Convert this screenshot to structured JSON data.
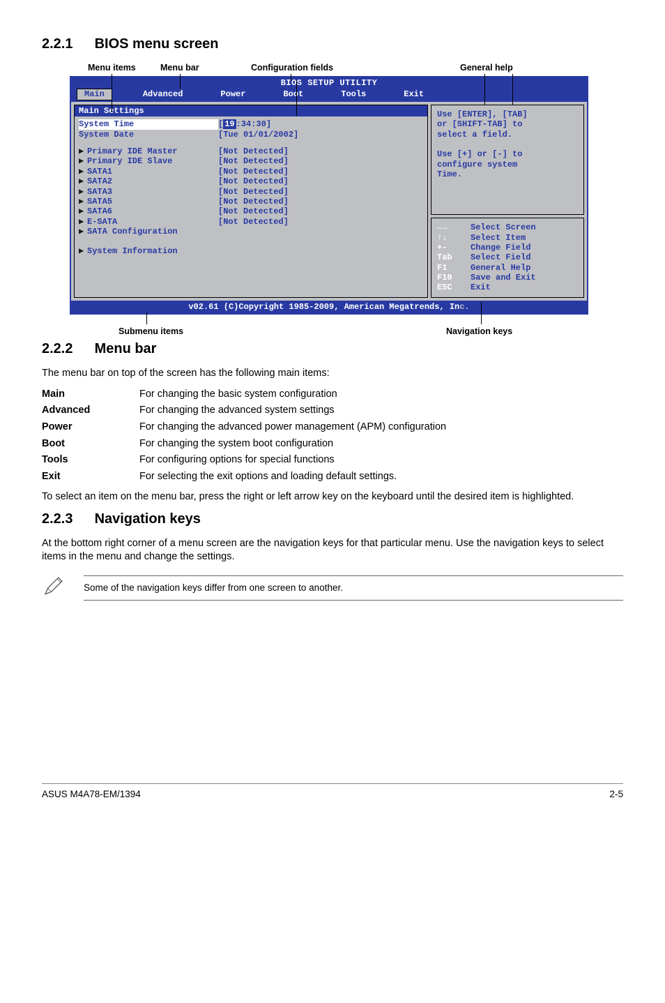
{
  "sec1": {
    "num": "2.2.1",
    "title": "BIOS menu screen"
  },
  "callouts_top": {
    "menu_items": "Menu items",
    "menu_bar": "Menu bar",
    "config_fields": "Configuration fields",
    "general_help": "General help"
  },
  "bios": {
    "title": "BIOS SETUP UTILITY",
    "tabs": {
      "main": "Main",
      "advanced": "Advanced",
      "power": "Power",
      "boot": "Boot",
      "tools": "Tools",
      "exit": "Exit"
    },
    "section_header": "Main Settings",
    "sys_time_lbl": "System Time",
    "sys_time_val": {
      "h": "19",
      "rest": ":34:30]"
    },
    "sys_date_lbl": "System Date",
    "sys_date_val": "[Tue 01/01/2002]",
    "rows": [
      {
        "lbl": "Primary IDE Master",
        "val": "[Not Detected]"
      },
      {
        "lbl": "Primary IDE Slave",
        "val": "[Not Detected]"
      },
      {
        "lbl": "SATA1",
        "val": "[Not Detected]"
      },
      {
        "lbl": "SATA2",
        "val": "[Not Detected]"
      },
      {
        "lbl": "SATA3",
        "val": "[Not Detected]"
      },
      {
        "lbl": "SATA5",
        "val": "[Not Detected]"
      },
      {
        "lbl": "SATA6",
        "val": "[Not Detected]"
      },
      {
        "lbl": "E-SATA",
        "val": "[Not Detected]"
      }
    ],
    "sata_cfg": "SATA Configuration",
    "sys_info": "System Information",
    "help_text": "Use [ENTER], [TAB]\nor [SHIFT-TAB] to\nselect a field.\n\nUse [+] or [-] to\nconfigure system\nTime.",
    "nav": [
      {
        "k": "←→",
        "d": "Select Screen"
      },
      {
        "k": "↑↓",
        "d": "Select Item"
      },
      {
        "k": "+-",
        "d": "Change Field"
      },
      {
        "k": "Tab",
        "d": "Select Field"
      },
      {
        "k": "F1",
        "d": "General Help"
      },
      {
        "k": "F10",
        "d": "Save and Exit"
      },
      {
        "k": "ESC",
        "d": "Exit"
      }
    ],
    "footer_a": "v02.61 (C)Copyright 1985-2009, American Megatrends, In",
    "footer_b": "c."
  },
  "callouts_bottom": {
    "submenu": "Submenu items",
    "navkeys": "Navigation keys"
  },
  "sec2": {
    "num": "2.2.2",
    "title": "Menu bar",
    "intro": "The menu bar on top of the screen has the following main items:",
    "rows": [
      {
        "k": "Main",
        "d": "For changing the basic system configuration"
      },
      {
        "k": "Advanced",
        "d": "For changing the advanced system settings"
      },
      {
        "k": "Power",
        "d": "For changing the advanced power management (APM) configuration"
      },
      {
        "k": "Boot",
        "d": "For changing the system boot configuration"
      },
      {
        "k": "Tools",
        "d": "For configuring options for special functions"
      },
      {
        "k": "Exit",
        "d": "For selecting the exit options and loading default settings."
      }
    ],
    "outro": "To select an item on the menu bar, press the right or left arrow key on the keyboard until the desired item is highlighted."
  },
  "sec3": {
    "num": "2.2.3",
    "title": "Navigation keys",
    "body": "At the bottom right corner of a menu screen are the navigation keys for that particular menu. Use the navigation keys to select items in the menu and change the settings."
  },
  "note": "Some of the navigation keys differ from one screen to another.",
  "footer": {
    "left": "ASUS M4A78-EM/1394",
    "right": "2-5"
  }
}
